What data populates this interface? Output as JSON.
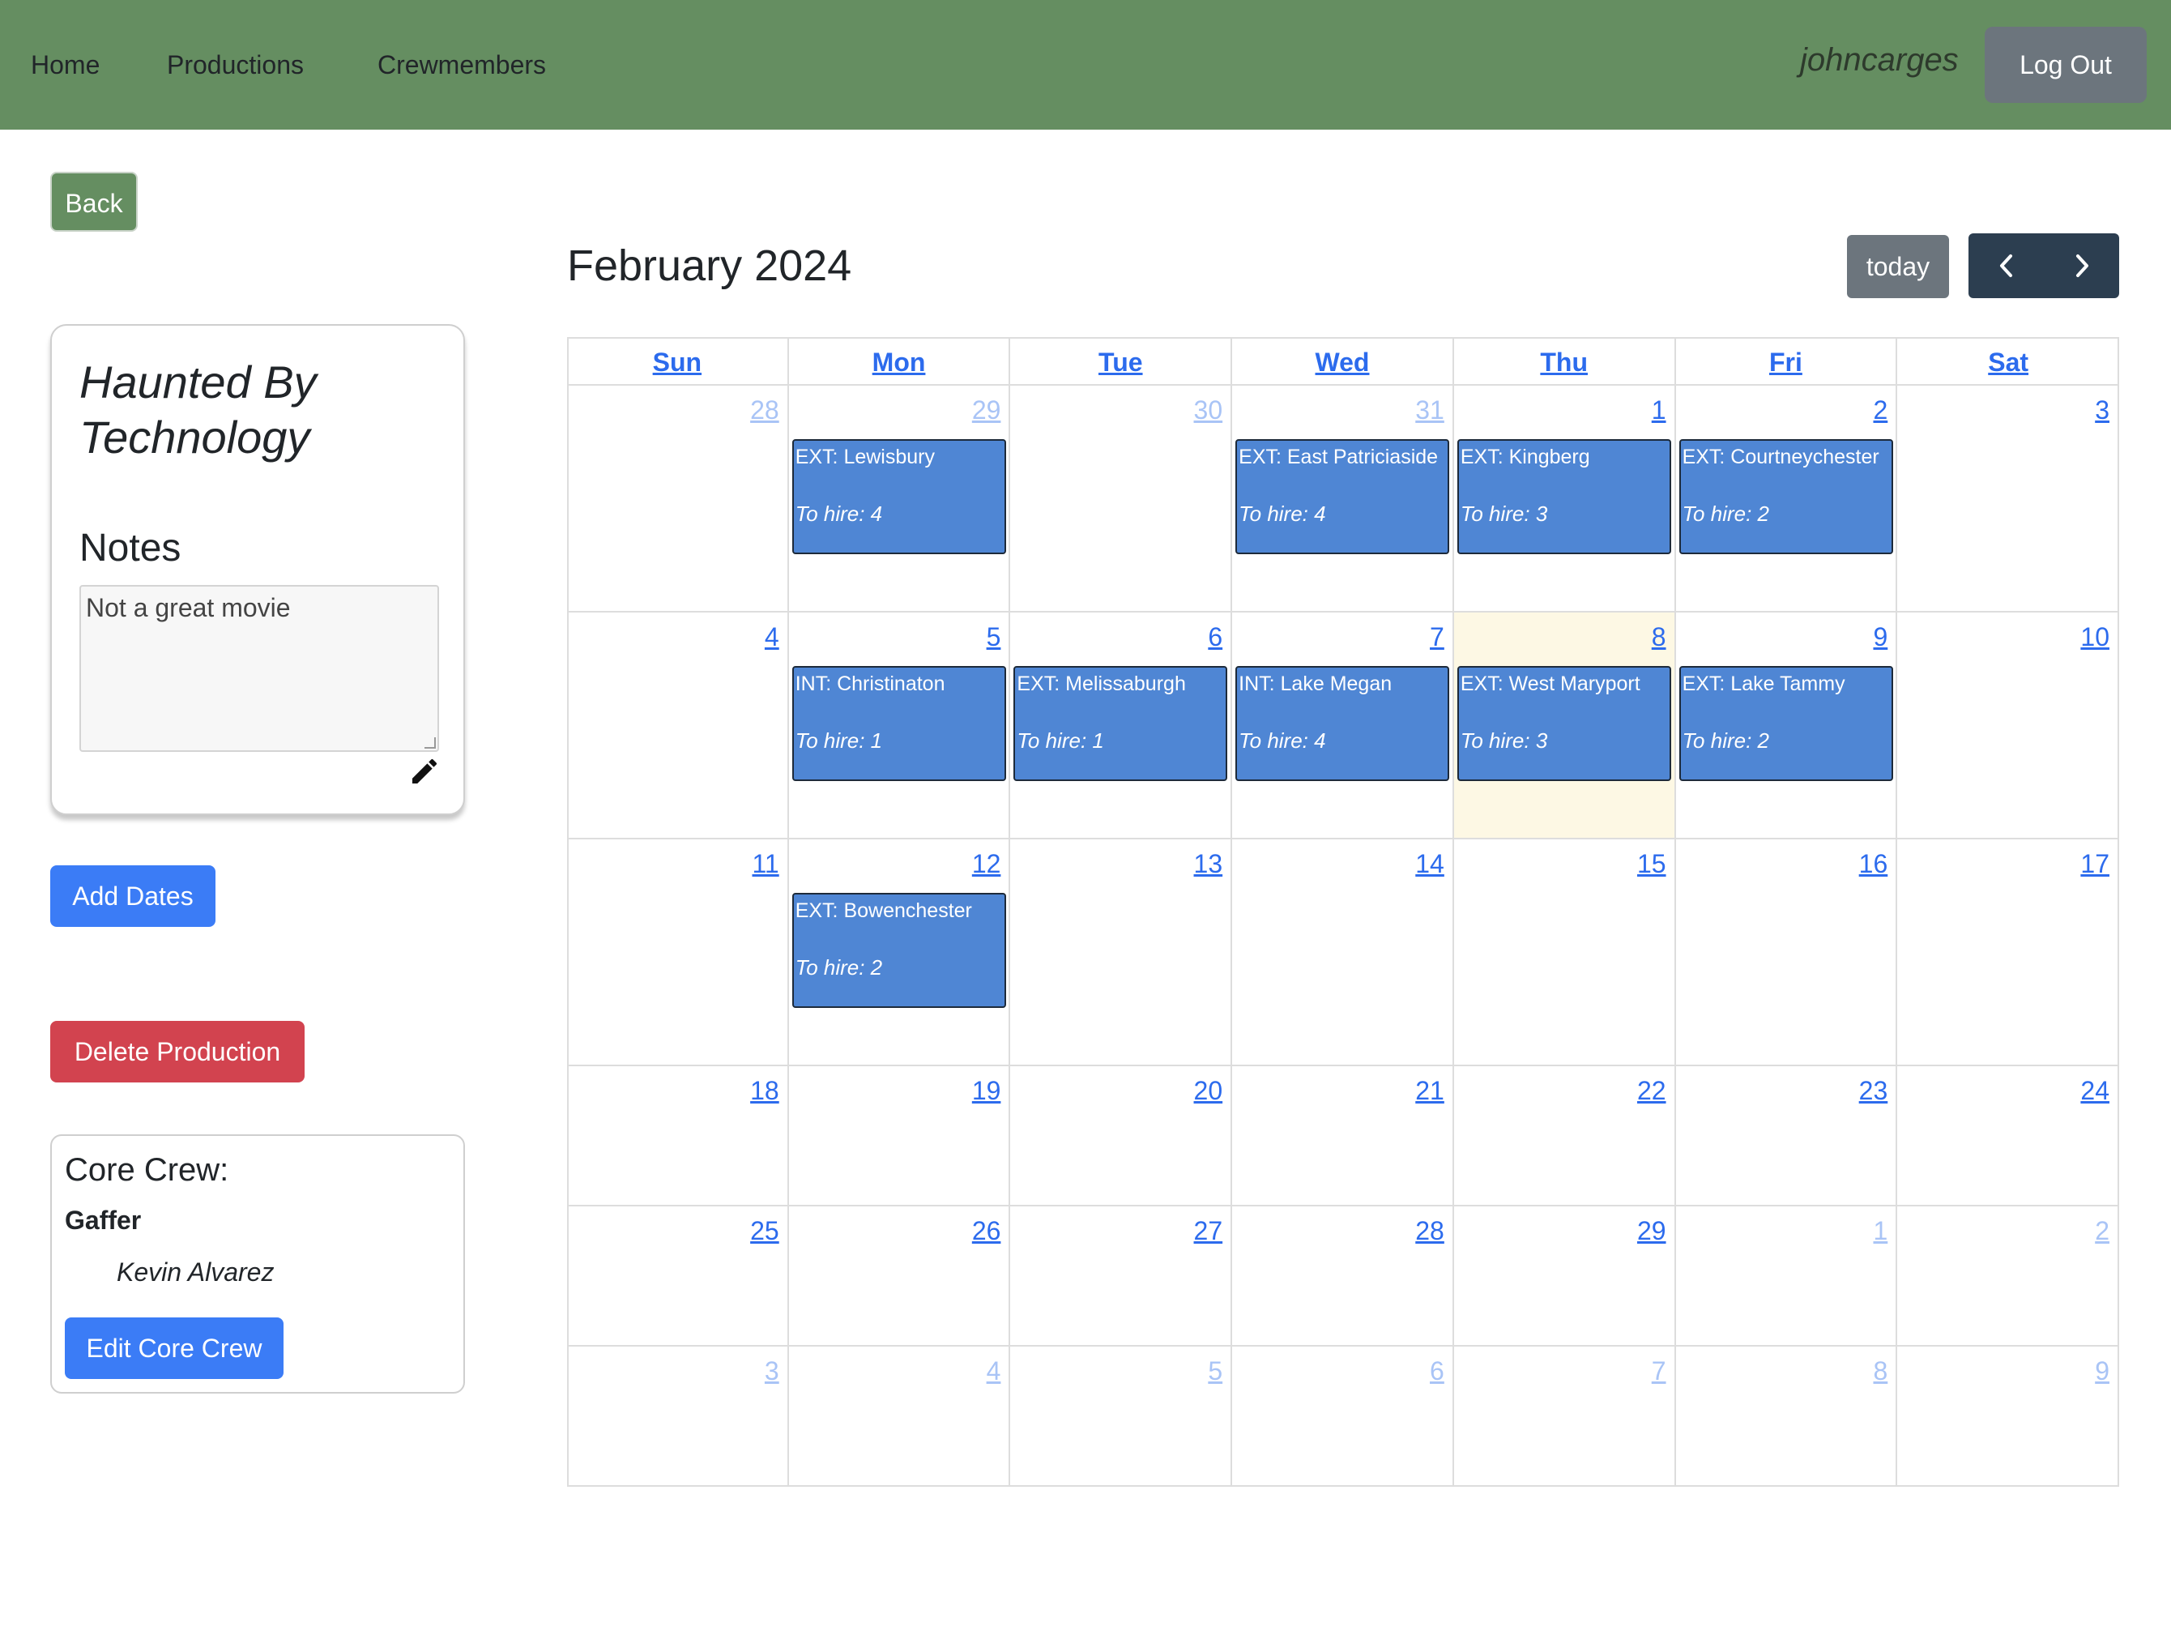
{
  "nav": {
    "links": [
      "Home",
      "Productions",
      "Crewmembers"
    ],
    "username": "johncarges",
    "logout_label": "Log Out"
  },
  "sidebar": {
    "back_label": "Back",
    "production_title": "Haunted By Technology",
    "notes_heading": "Notes",
    "notes_value": "Not a great movie",
    "add_dates_label": "Add Dates",
    "delete_label": "Delete Production",
    "core_crew": {
      "heading": "Core Crew:",
      "role": "Gaffer",
      "member": "Kevin Alvarez",
      "edit_label": "Edit Core Crew"
    }
  },
  "calendar": {
    "title": "February 2024",
    "today_label": "today",
    "weekdays": [
      "Sun",
      "Mon",
      "Tue",
      "Wed",
      "Thu",
      "Fri",
      "Sat"
    ],
    "today_cell": "2024-02-08",
    "weeks": [
      [
        {
          "day": "28",
          "other": true
        },
        {
          "day": "29",
          "other": true,
          "event": {
            "title": "EXT: Lewisbury",
            "hire": "To hire: 4"
          }
        },
        {
          "day": "30",
          "other": true
        },
        {
          "day": "31",
          "other": true,
          "event": {
            "title": "EXT: East Patriciaside",
            "hire": "To hire: 4"
          }
        },
        {
          "day": "1",
          "event": {
            "title": "EXT: Kingberg",
            "hire": "To hire: 3"
          }
        },
        {
          "day": "2",
          "event": {
            "title": "EXT: Courtneychester",
            "hire": "To hire: 2"
          }
        },
        {
          "day": "3"
        }
      ],
      [
        {
          "day": "4"
        },
        {
          "day": "5",
          "event": {
            "title": "INT: Christinaton",
            "hire": "To hire: 1"
          }
        },
        {
          "day": "6",
          "event": {
            "title": "EXT: Melissaburgh",
            "hire": "To hire: 1"
          }
        },
        {
          "day": "7",
          "event": {
            "title": "INT: Lake Megan",
            "hire": "To hire: 4"
          }
        },
        {
          "day": "8",
          "today": true,
          "event": {
            "title": "EXT: West Maryport",
            "hire": "To hire: 3"
          }
        },
        {
          "day": "9",
          "event": {
            "title": "EXT: Lake Tammy",
            "hire": "To hire: 2"
          }
        },
        {
          "day": "10"
        }
      ],
      [
        {
          "day": "11"
        },
        {
          "day": "12",
          "event": {
            "title": "EXT: Bowenchester",
            "hire": "To hire: 2"
          }
        },
        {
          "day": "13"
        },
        {
          "day": "14"
        },
        {
          "day": "15"
        },
        {
          "day": "16"
        },
        {
          "day": "17"
        }
      ],
      [
        {
          "day": "18"
        },
        {
          "day": "19"
        },
        {
          "day": "20"
        },
        {
          "day": "21"
        },
        {
          "day": "22"
        },
        {
          "day": "23"
        },
        {
          "day": "24"
        }
      ],
      [
        {
          "day": "25"
        },
        {
          "day": "26"
        },
        {
          "day": "27"
        },
        {
          "day": "28"
        },
        {
          "day": "29"
        },
        {
          "day": "1",
          "other": true
        },
        {
          "day": "2",
          "other": true
        }
      ],
      [
        {
          "day": "3",
          "other": true
        },
        {
          "day": "4",
          "other": true
        },
        {
          "day": "5",
          "other": true
        },
        {
          "day": "6",
          "other": true
        },
        {
          "day": "7",
          "other": true
        },
        {
          "day": "8",
          "other": true
        },
        {
          "day": "9",
          "other": true
        }
      ]
    ]
  },
  "icons": {
    "edit": "pencil-icon",
    "prev": "chevron-left-icon",
    "next": "chevron-right-icon"
  },
  "colors": {
    "navbar": "#658e61",
    "primary": "#3b7cf6",
    "danger": "#d2434f",
    "event": "#4f86d4",
    "today_highlight": "#fdf8e4"
  }
}
